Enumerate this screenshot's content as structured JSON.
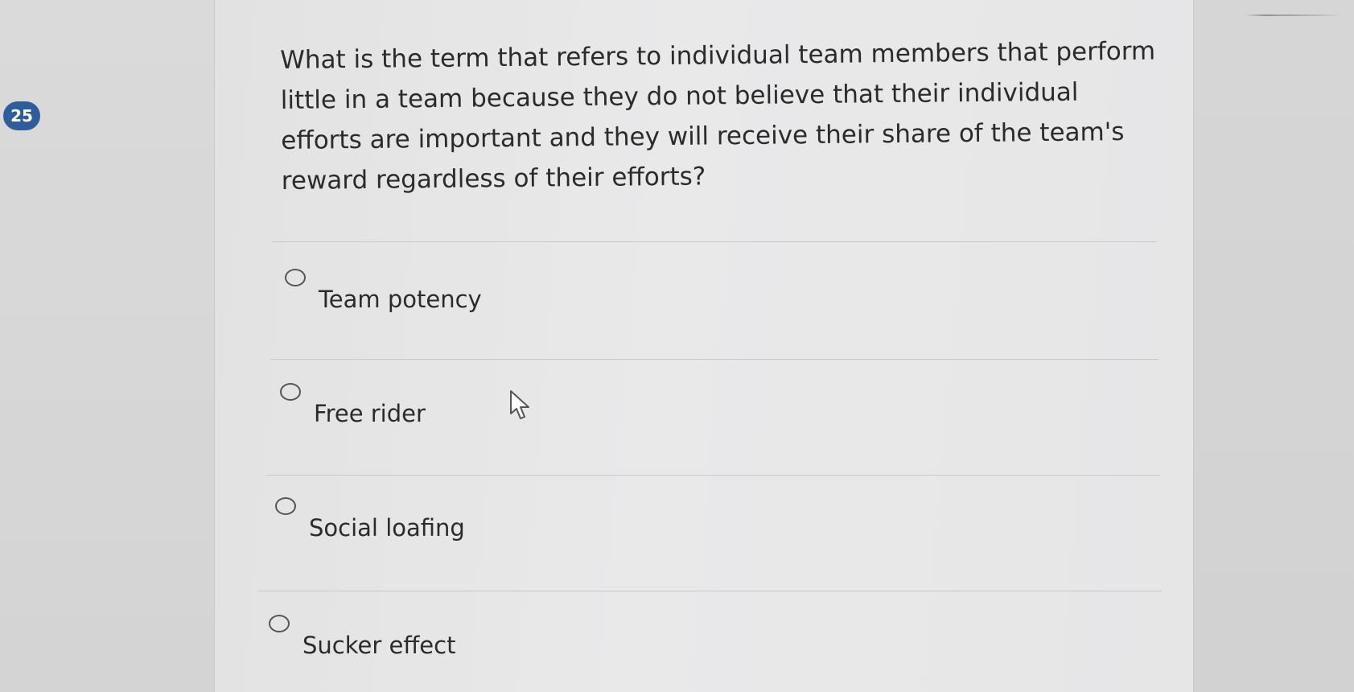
{
  "question": {
    "number": "25",
    "text": "What is the term that refers to individual team members that perform little in a team because they do not believe that their individual efforts are important and they will receive their share of the team's reward regardless of their efforts?"
  },
  "options": [
    {
      "label": "Team potency",
      "selected": false
    },
    {
      "label": "Free rider",
      "selected": false
    },
    {
      "label": "Social loafing",
      "selected": false
    },
    {
      "label": "Sucker effect",
      "selected": false
    }
  ],
  "colors": {
    "badge": "#2d5d9a",
    "text": "#2b2b2b"
  },
  "icons": {
    "cursor": "mouse-pointer-icon"
  }
}
